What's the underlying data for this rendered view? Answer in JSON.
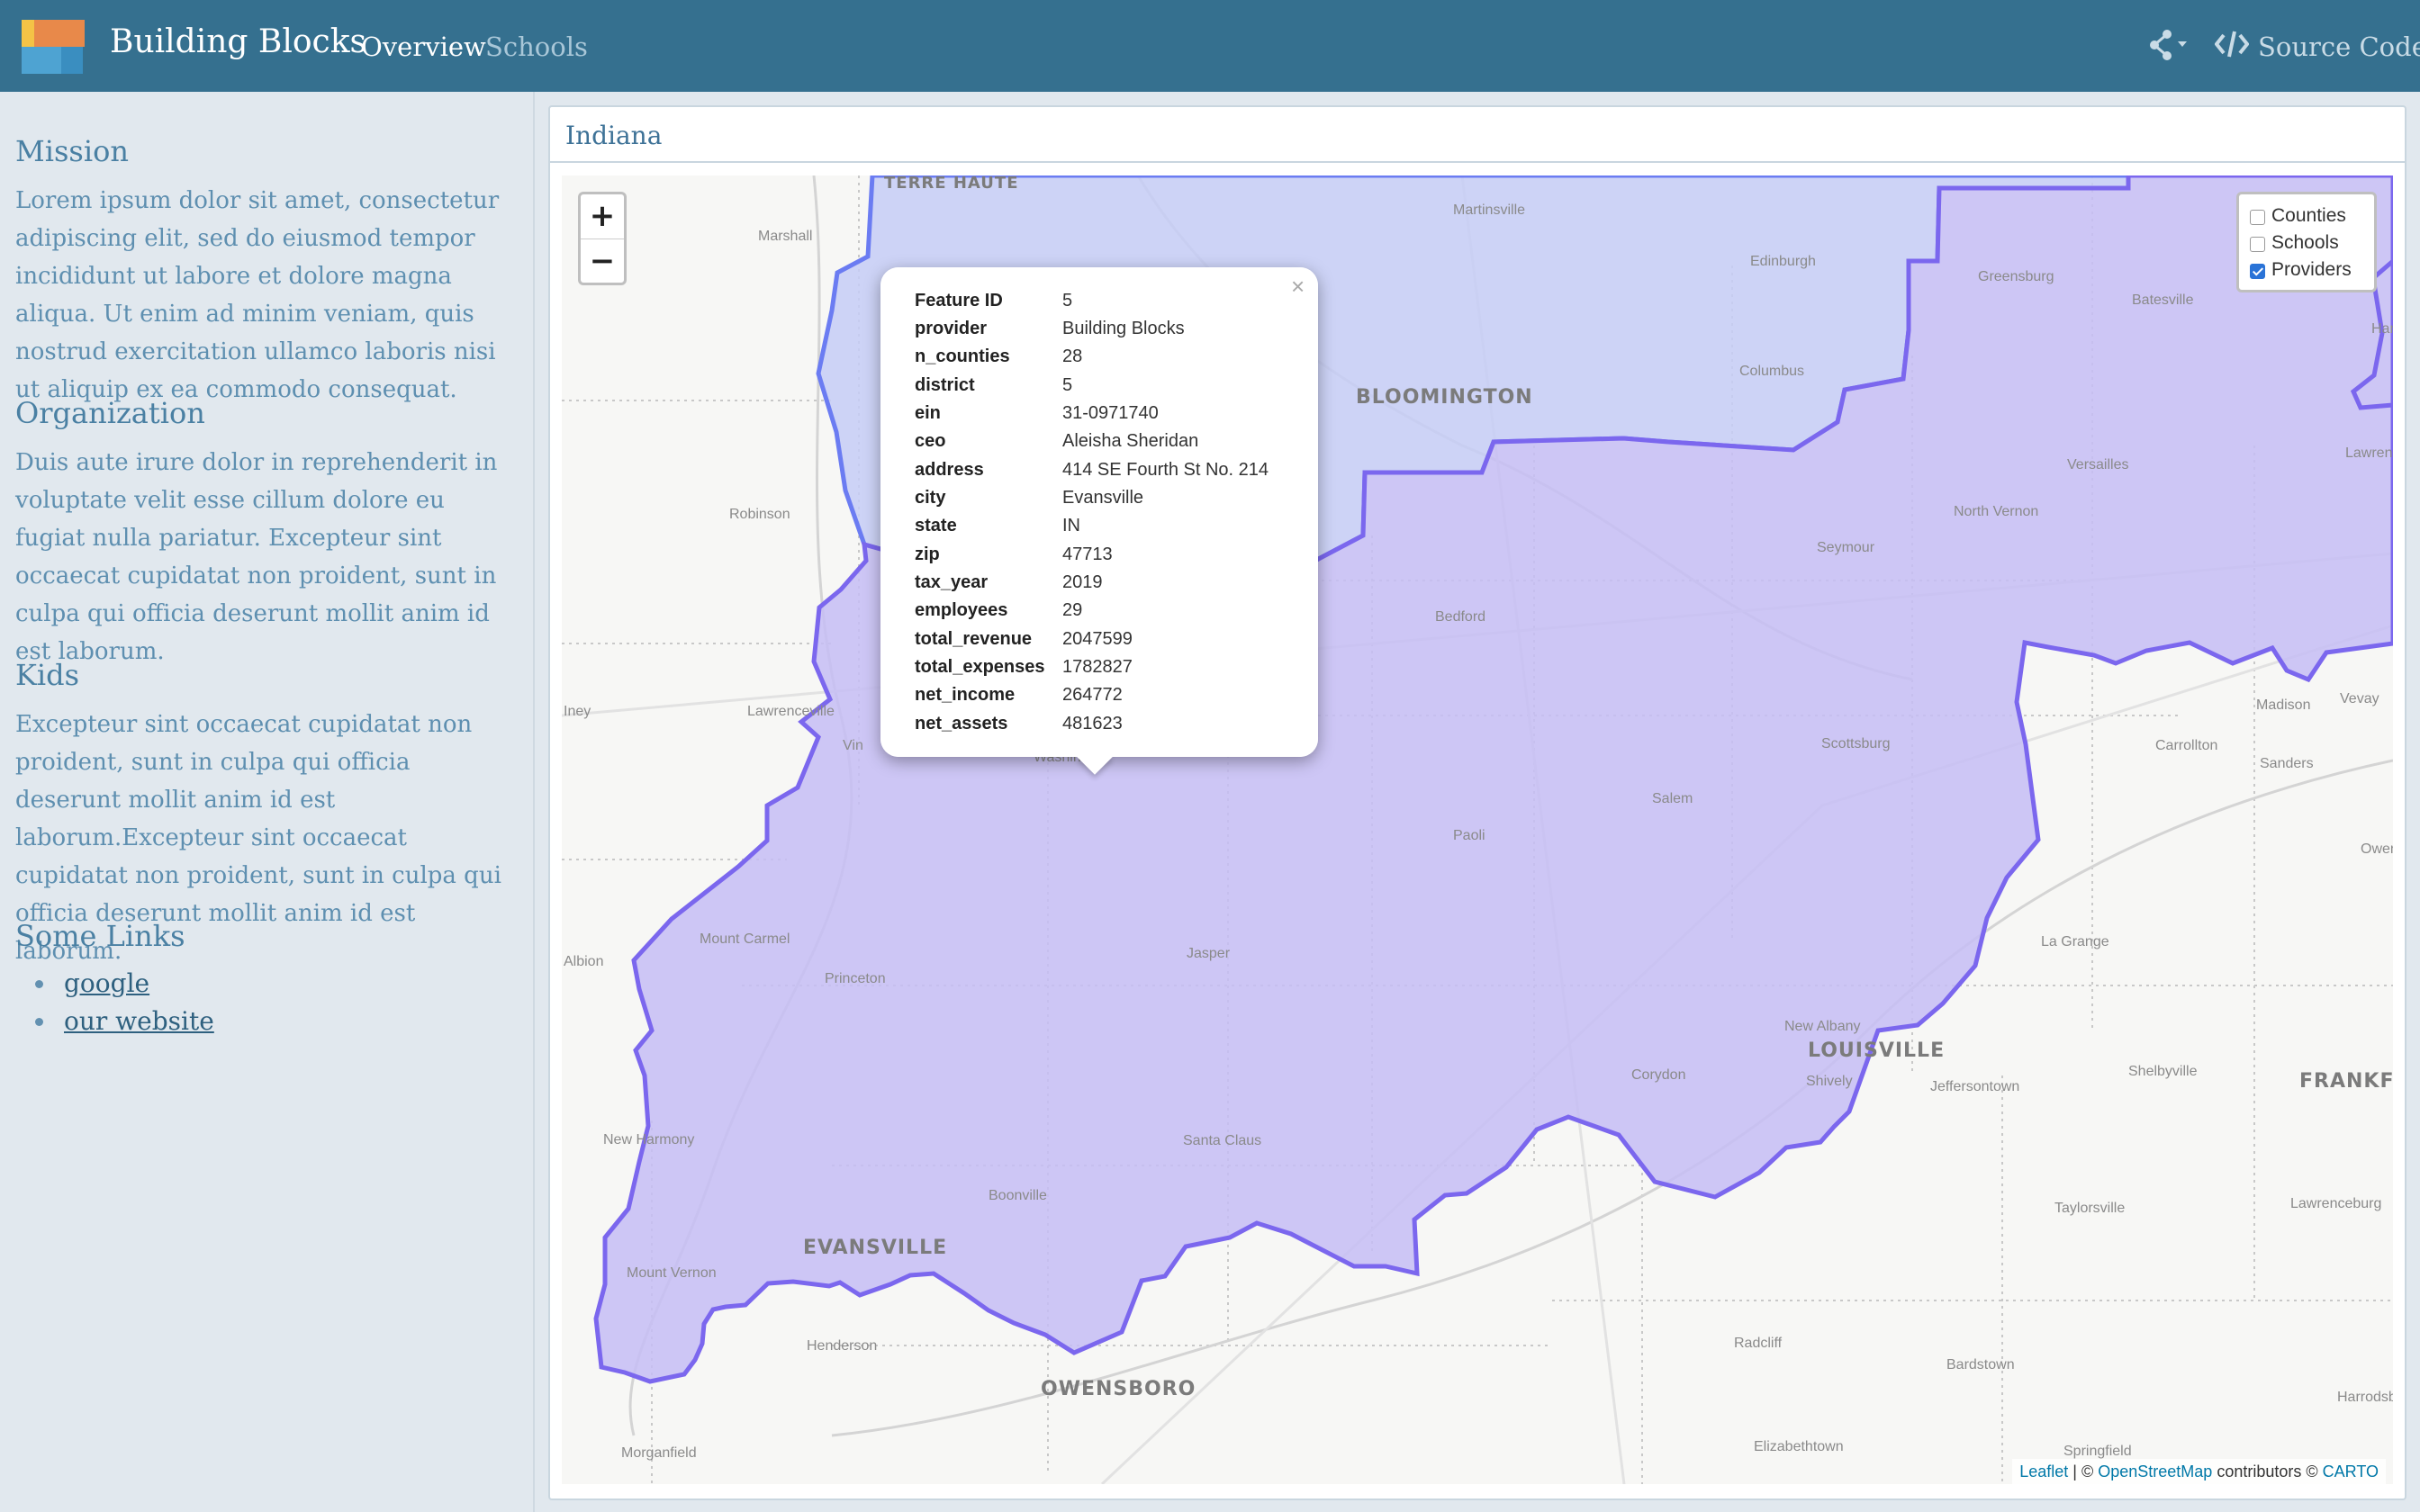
{
  "navbar": {
    "brand": "Building Blocks",
    "links": [
      "Overview",
      "Schools"
    ],
    "source_code": "Source Code",
    "colors": {
      "bar": "#35708f",
      "logo_orange": "#e8894a",
      "logo_yellow": "#f4c346",
      "logo_blue": "#4ea3d2"
    }
  },
  "sidebar": {
    "sections": [
      {
        "heading": "Mission",
        "text": "Lorem ipsum dolor sit amet, consectetur adipiscing elit, sed do eiusmod tempor incididunt ut labore et dolore magna aliqua. Ut enim ad minim veniam, quis nostrud exercitation ullamco laboris nisi ut aliquip ex ea commodo consequat."
      },
      {
        "heading": "Organization",
        "text": "Duis aute irure dolor in reprehenderit in voluptate velit esse cillum dolore eu fugiat nulla pariatur. Excepteur sint occaecat cupidatat non proident, sunt in culpa qui officia deserunt mollit anim id est laborum."
      },
      {
        "heading": "Kids",
        "text": "Excepteur sint occaecat cupidatat non proident, sunt in culpa qui officia deserunt mollit anim id est laborum.Excepteur sint occaecat cupidatat non proident, sunt in culpa qui officia deserunt mollit anim id est laborum."
      },
      {
        "heading": "Some Links",
        "text": ""
      }
    ],
    "links": [
      "google",
      "our website"
    ]
  },
  "panel": {
    "title": "Indiana"
  },
  "map": {
    "zoom_in": "+",
    "zoom_out": "−",
    "layers": [
      {
        "label": "Counties",
        "checked": false
      },
      {
        "label": "Schools",
        "checked": false
      },
      {
        "label": "Providers",
        "checked": true
      }
    ],
    "popup": {
      "close": "×",
      "rows": [
        {
          "key": "Feature ID",
          "value": "5"
        },
        {
          "key": "provider",
          "value": "Building Blocks"
        },
        {
          "key": "n_counties",
          "value": "28"
        },
        {
          "key": "district",
          "value": "5"
        },
        {
          "key": "ein",
          "value": "31-0971740"
        },
        {
          "key": "ceo",
          "value": "Aleisha Sheridan"
        },
        {
          "key": "address",
          "value": "414 SE Fourth St No. 214"
        },
        {
          "key": "city",
          "value": "Evansville"
        },
        {
          "key": "state",
          "value": "IN"
        },
        {
          "key": "zip",
          "value": "47713"
        },
        {
          "key": "tax_year",
          "value": "2019"
        },
        {
          "key": "employees",
          "value": "29"
        },
        {
          "key": "total_revenue",
          "value": "2047599"
        },
        {
          "key": "total_expenses",
          "value": "1782827"
        },
        {
          "key": "net_income",
          "value": "264772"
        },
        {
          "key": "net_assets",
          "value": "481623"
        }
      ]
    },
    "attribution": {
      "leaflet": "Leaflet",
      "sep1": " | © ",
      "osm": "OpenStreetMap",
      "contrib": " contributors © ",
      "carto": "CARTO"
    },
    "major_cities": [
      "TERRE HAUTE",
      "BLOOMINGTON",
      "LOUISVILLE",
      "EVANSVILLE",
      "OWENSBORO",
      "FRANKFO"
    ],
    "places": [
      "Martinsville",
      "Marshall",
      "Edinburgh",
      "Greensburg",
      "Batesville",
      "Harr",
      "Columbus",
      "Versailles",
      "Lawrence Aurora",
      "Robinson",
      "North Vernon",
      "Seymour",
      "Bedford",
      "Lawrenceville",
      "Iney",
      "Madison",
      "Vevay",
      "Carrollton",
      "Sanders",
      "Scottsburg",
      "Vin",
      "Washin",
      "Salem",
      "Paoli",
      "Owento",
      "Mount Carmel",
      "Albion",
      "Princeton",
      "Jasper",
      "La Grange",
      "New Albany",
      "Shively",
      "Jeffersontown",
      "Shelbyville",
      "Corydon",
      "New Harmony",
      "Santa Claus",
      "Boonville",
      "Taylorsville",
      "Lawrenceburg",
      "Mount Vernon",
      "Henderson",
      "Radcliff",
      "Bardstown",
      "Harrodsb",
      "Morganfield",
      "Elizabethtown",
      "Springfield"
    ]
  }
}
